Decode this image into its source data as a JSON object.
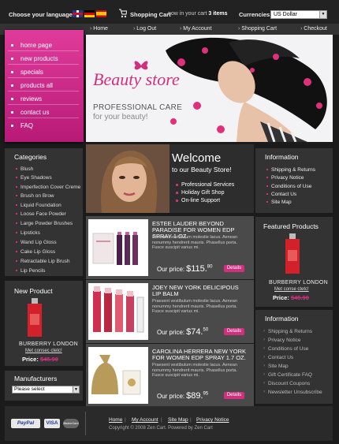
{
  "top": {
    "language_label": "Choose your language:",
    "languages": [
      "English",
      "Deutsch",
      "Español"
    ],
    "cart_label": "Shopping Cart",
    "cart_status_prefix": "now in your cart",
    "cart_count": "3 items",
    "currency_label": "Currencies:",
    "currency_value": "US Dollar"
  },
  "nav": {
    "home": "Home",
    "logout": "Log Out",
    "account": "My Account",
    "cart": "Shopping Cart",
    "checkout": "Checkout"
  },
  "sidenav": [
    "home page",
    "new products",
    "specials",
    "products all",
    "reviews",
    "contact us",
    "FAQ"
  ],
  "banner": {
    "logo": "Beauty store",
    "tagline_1": "PROFESSIONAL CARE",
    "tagline_2": "for your beauty!"
  },
  "categories": {
    "title": "Categories",
    "items": [
      "Blush",
      "Eye Shadows",
      "Imperfection Cover Creme",
      "Brush on Brow",
      "Liquid Foundation",
      "Loose Face Powder",
      "Large Powder Brushes",
      "Lipsticks",
      "Wand Lip Gloss",
      "Cake Lip Gloss",
      "Retractable Lip Brush",
      "Lip Pencils"
    ]
  },
  "new_product": {
    "title": "New Product",
    "brand": "BURBERRY LONDON",
    "note": "Met consec ctetc!",
    "price_label": "Price:",
    "price": "$45.90"
  },
  "manufacturers": {
    "title": "Manufacturers",
    "select_value": "Please select"
  },
  "welcome": {
    "line1": "Welcome",
    "line2": "to our Beauty Store!",
    "items": [
      "Professional Services",
      "Holiday Gift Shop",
      "On-line Support"
    ]
  },
  "products": [
    {
      "title": "ESTEE LAUDER BEYOND PARADISE FOR WOMEN EDP SPRAY 1 OZ.",
      "desc": "Praesent vestibulum molestie lacus. Aenean nonummy hendrerit mauris. Phasellus porta. Fusce suscipit varius mi.",
      "price_label": "Our price:",
      "price_main": "$115.",
      "price_cents": "80",
      "details": "Details"
    },
    {
      "title": "JOEY NEW YORK DELICIPOUS LIP BALM",
      "desc": "Praesent vestibulum molestie lacus. Aenean nonummy hendrerit mauris. Phasellus porta. Fusce suscipit varius mi.",
      "price_label": "Our price:",
      "price_main": "$74.",
      "price_cents": "50",
      "details": "Details"
    },
    {
      "title": "CAROLINA HERRERA NEW YORK FOR WOMEN EDP SPRAY 1.7 OZ.",
      "desc": "Praesent vestibulum molestie lacus. Aenean nonummy hendrerit mauris. Phasellus porta. Fusce suscipit varius mi.",
      "price_label": "Our price:",
      "price_main": "$89.",
      "price_cents": "95",
      "details": "Details"
    }
  ],
  "info1": {
    "title": "Information",
    "items": [
      "Shipping & Returns",
      "Privacy Notice",
      "Conditions of Use",
      "Contact Us",
      "Site Map"
    ]
  },
  "featured": {
    "title": "Featured Products",
    "brand": "BURBERRY LONDON",
    "note": "Met conse ctetc!",
    "price_label": "Price:",
    "price": "$45.90"
  },
  "info2": {
    "title": "Information",
    "items": [
      "Shipping & Returns",
      "Privacy Notice",
      "Conditions of Use",
      "Contact Us",
      "Site Map",
      "Gift Certificate FAQ",
      "Discount Coupons",
      "Newsletter Unsubscribe"
    ]
  },
  "footer": {
    "links": [
      "Home",
      "My Account",
      "Site Map",
      "Privacy Notice"
    ],
    "copyright": "Copyright © 2008 Zen Cart. Powered by Zen Cart",
    "payments": [
      "PayPal",
      "VISA",
      "MasterCard"
    ]
  },
  "colors": {
    "accent": "#d0317f",
    "bg": "#1b1b1b",
    "panel": "#333333"
  }
}
